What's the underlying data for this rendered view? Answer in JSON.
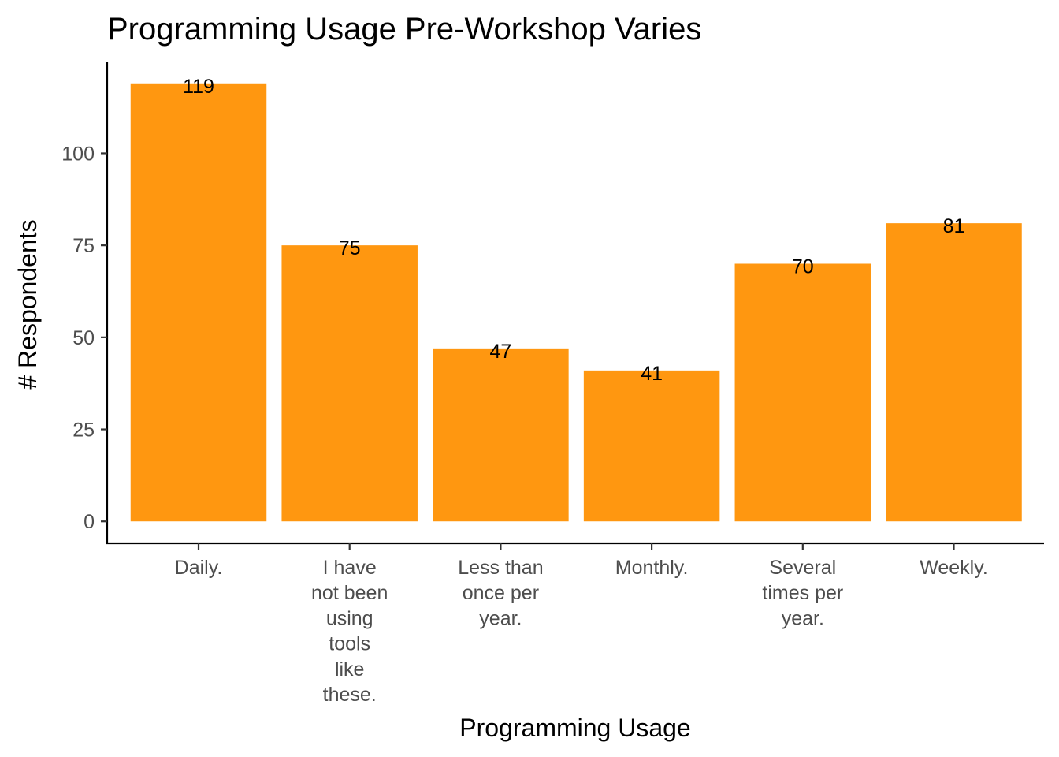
{
  "chart_data": {
    "type": "bar",
    "title": "Programming Usage Pre-Workshop Varies",
    "xlabel": "Programming Usage",
    "ylabel": "# Respondents",
    "categories": [
      [
        "Daily."
      ],
      [
        "I have",
        "not been",
        "using",
        "tools",
        "like",
        "these."
      ],
      [
        "Less than",
        "once per",
        "year."
      ],
      [
        "Monthly."
      ],
      [
        "Several",
        "times per",
        "year."
      ],
      [
        "Weekly."
      ]
    ],
    "values": [
      119,
      75,
      47,
      41,
      70,
      81
    ],
    "data_labels": [
      "119",
      "75",
      "47",
      "41",
      "70",
      "81"
    ],
    "yticks": [
      0,
      25,
      50,
      75,
      100
    ],
    "ylim": [
      -5.95,
      124.95
    ],
    "grid": false,
    "legend": "none",
    "bar_color": "#FF9710"
  }
}
